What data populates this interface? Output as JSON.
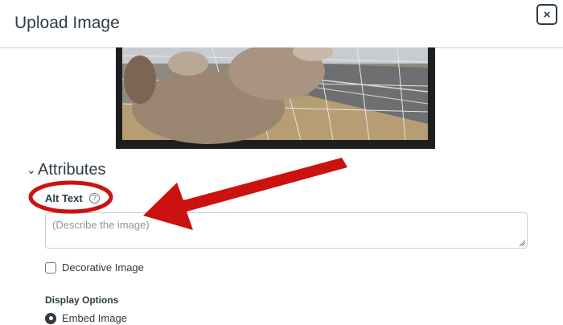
{
  "dialog": {
    "title": "Upload Image",
    "close_label": "×"
  },
  "attributes": {
    "section_title": "Attributes",
    "alt_text": {
      "label": "Alt Text",
      "help_icon": "question-circle-icon",
      "help_glyph": "?",
      "placeholder": "(Describe the image)",
      "value": ""
    },
    "decorative_label": "Decorative Image",
    "display_options": {
      "label": "Display Options",
      "selected": "Embed Image"
    }
  },
  "annotation": {
    "color": "#cc1111"
  }
}
